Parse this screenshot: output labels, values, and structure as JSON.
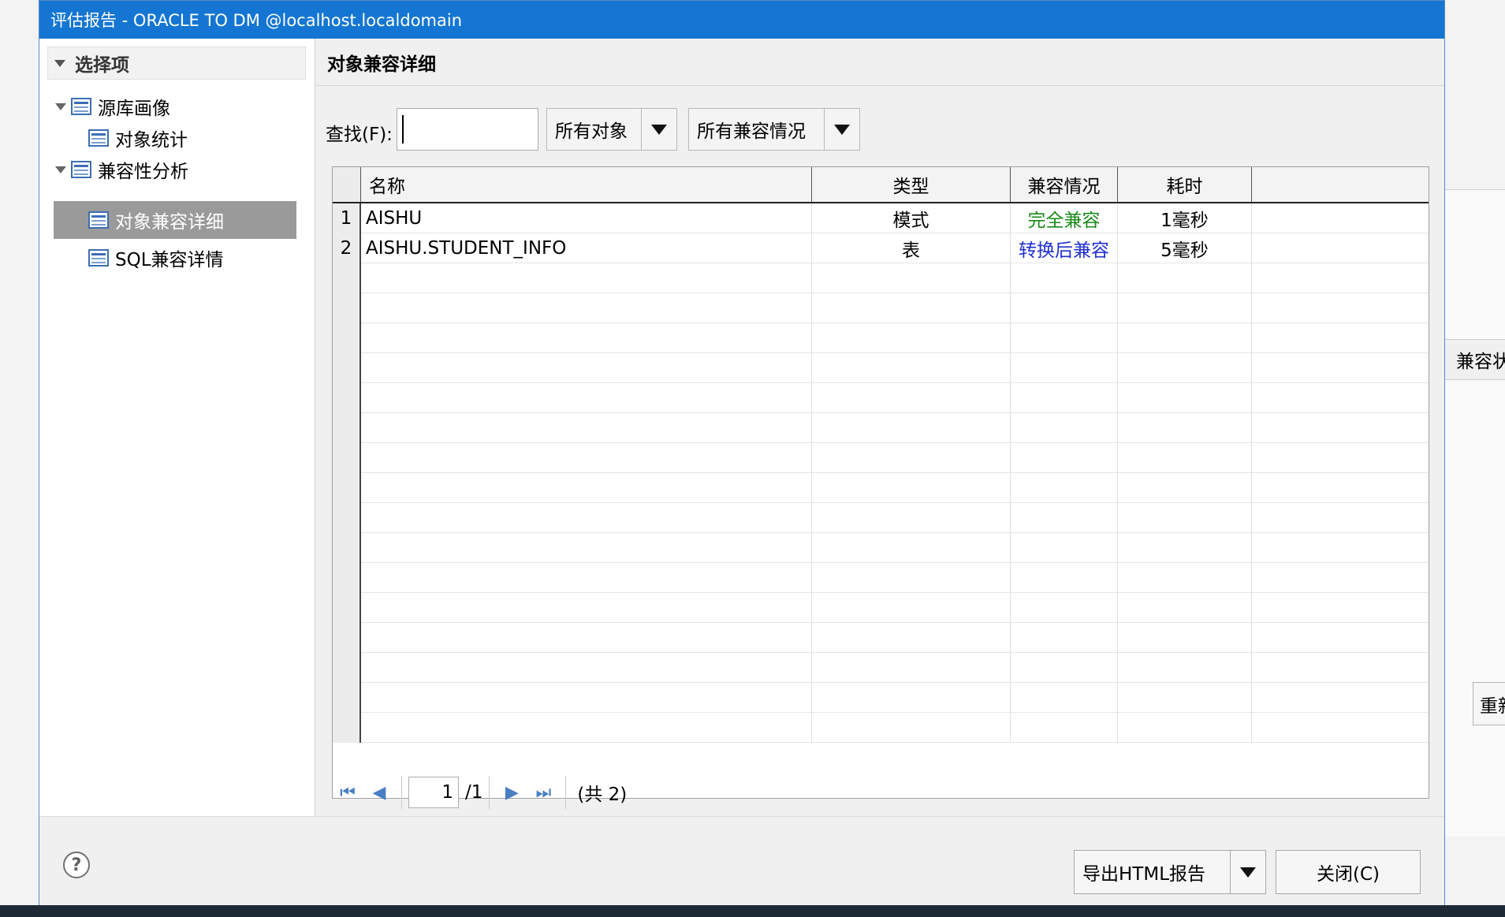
{
  "dialog": {
    "title": "评估报告 - ORACLE TO DM @localhost.localdomain"
  },
  "tree": {
    "header": "选择项",
    "items": [
      {
        "label": "源库画像"
      },
      {
        "label": "对象统计"
      },
      {
        "label": "兼容性分析"
      },
      {
        "label": "对象兼容详细"
      },
      {
        "label": "SQL兼容详情"
      }
    ]
  },
  "main": {
    "title": "对象兼容详细",
    "search_label": "查找(F):",
    "search_value": "",
    "object_filter": "所有对象",
    "compat_filter": "所有兼容情况"
  },
  "grid": {
    "columns": [
      "名称",
      "类型",
      "兼容情况",
      "耗时"
    ],
    "rows": [
      {
        "num": "1",
        "name": "AISHU",
        "type": "模式",
        "compat": "完全兼容",
        "compat_color": "#1a8a1a",
        "time": "1毫秒"
      },
      {
        "num": "2",
        "name": "AISHU.STUDENT_INFO",
        "type": "表",
        "compat": "转换后兼容",
        "compat_color": "#1f2fd0",
        "time": "5毫秒"
      }
    ],
    "empty_rows": 16
  },
  "pager": {
    "current_page": "1",
    "total_pages": "/1",
    "total_count": "(共 2)"
  },
  "footer": {
    "export_label": "导出HTML报告",
    "close_label": "关闭(C)"
  },
  "background": {
    "right_header": "兼容状",
    "right_button": "重新"
  }
}
